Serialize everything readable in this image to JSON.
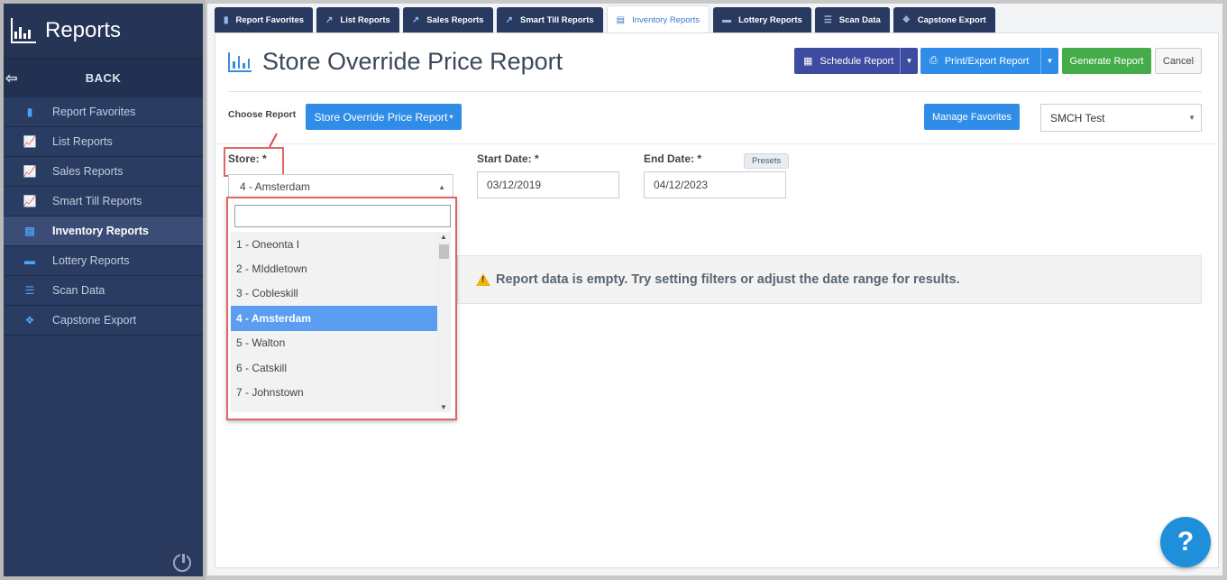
{
  "sidebar": {
    "title": "Reports",
    "back_label": "BACK",
    "items": [
      {
        "label": "Report Favorites",
        "icon": "bookmark-icon"
      },
      {
        "label": "List Reports",
        "icon": "line-chart-icon"
      },
      {
        "label": "Sales Reports",
        "icon": "line-chart-icon"
      },
      {
        "label": "Smart Till Reports",
        "icon": "line-chart-icon"
      },
      {
        "label": "Inventory Reports",
        "icon": "inventory-icon"
      },
      {
        "label": "Lottery Reports",
        "icon": "ticket-icon"
      },
      {
        "label": "Scan Data",
        "icon": "list-icon"
      },
      {
        "label": "Capstone Export",
        "icon": "cubes-icon"
      }
    ],
    "active_item": "Inventory Reports"
  },
  "tabs": [
    {
      "label": "Report Favorites"
    },
    {
      "label": "List Reports"
    },
    {
      "label": "Sales Reports"
    },
    {
      "label": "Smart Till Reports"
    },
    {
      "label": "Inventory Reports"
    },
    {
      "label": "Lottery Reports"
    },
    {
      "label": "Scan Data"
    },
    {
      "label": "Capstone Export"
    }
  ],
  "page": {
    "title": "Store Override Price Report",
    "schedule_label": "Schedule Report",
    "print_label": "Print/Export Report",
    "generate_label": "Generate Report",
    "cancel_label": "Cancel",
    "choose_label": "Choose Report",
    "choose_value": "Store Override Price Report",
    "manage_favorites": "Manage Favorites",
    "company_select": "SMCH Test"
  },
  "filters": {
    "store_label": "Store: *",
    "store_value": "4 - Amsterdam",
    "start_label": "Start Date: *",
    "start_value": "03/12/2019",
    "end_label": "End Date: *",
    "end_value": "04/12/2023",
    "presets_label": "Presets"
  },
  "store_options": [
    "1 - Oneonta I",
    "2 - MIddletown",
    "3 - Cobleskill",
    "4 - Amsterdam",
    "5 - Walton",
    "6 - Catskill",
    "7 - Johnstown"
  ],
  "selected_option": "4 - Amsterdam",
  "alert": {
    "text": "Report data is empty. Try setting filters or adjust the date range for results."
  },
  "help": {
    "label": "?"
  },
  "colors": {
    "sidebar_bg": "#2a3a5e",
    "primary": "#2f8de8",
    "schedule": "#3d4ca0",
    "generate": "#44ad4a",
    "highlight_box": "#e06666"
  }
}
